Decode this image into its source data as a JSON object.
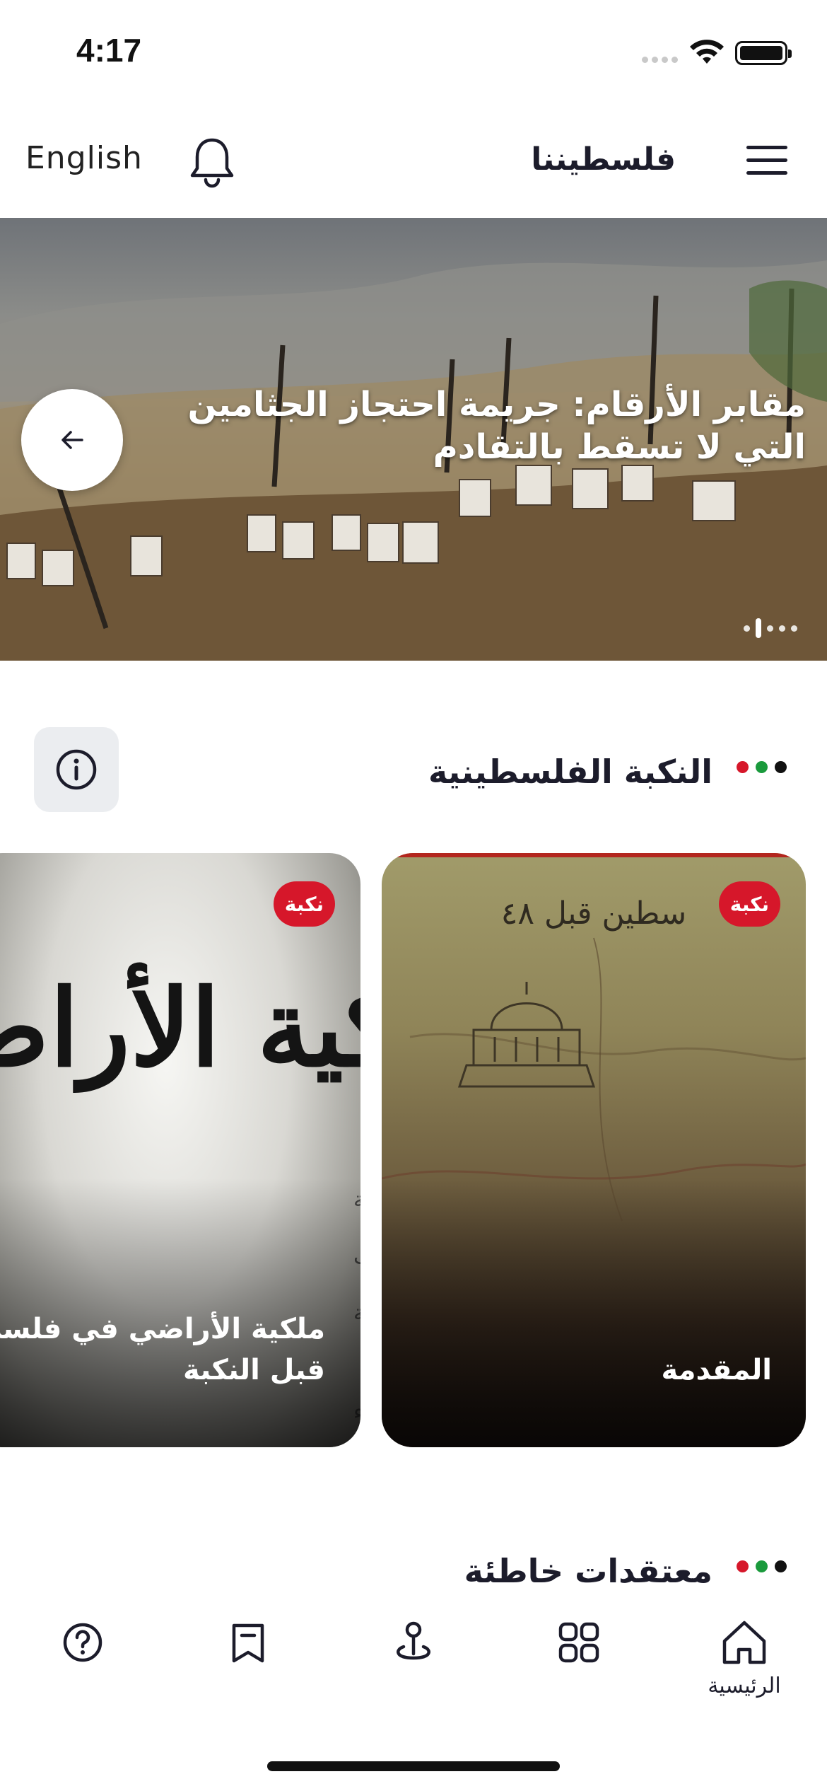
{
  "status_bar": {
    "time": "4:17"
  },
  "header": {
    "language_link": "English",
    "app_title": "فلسطيننا",
    "icons": {
      "notifications": "bell-icon",
      "menu": "hamburger-menu-icon"
    }
  },
  "hero": {
    "title": "مقابر الأرقام: جريمة احتجاز الجثامين التي لا تسقط بالتقادم",
    "arrow_icon": "arrow-left-icon",
    "slide_count": 5,
    "active_slide": 2
  },
  "section_nakba": {
    "title": "النكبة الفلسطينية",
    "info_icon": "info-icon",
    "flag_colors": [
      "#d6172a",
      "#1a9a3c",
      "#111111"
    ],
    "cards": [
      {
        "badge": "نكبة",
        "title": "المقدمة"
      },
      {
        "badge": "نكبة",
        "title": "ملكية الأراضي في فلسطين قبل النكبة"
      }
    ]
  },
  "section_misconceptions": {
    "title": "معتقدات خاطئة"
  },
  "bottom_nav": {
    "items": [
      {
        "icon": "help-circle-icon",
        "label": ""
      },
      {
        "icon": "bookmark-icon",
        "label": ""
      },
      {
        "icon": "map-pin-icon",
        "label": ""
      },
      {
        "icon": "grid-icon",
        "label": ""
      },
      {
        "icon": "home-icon",
        "label": "الرئيسية"
      }
    ],
    "active_index": 4
  }
}
